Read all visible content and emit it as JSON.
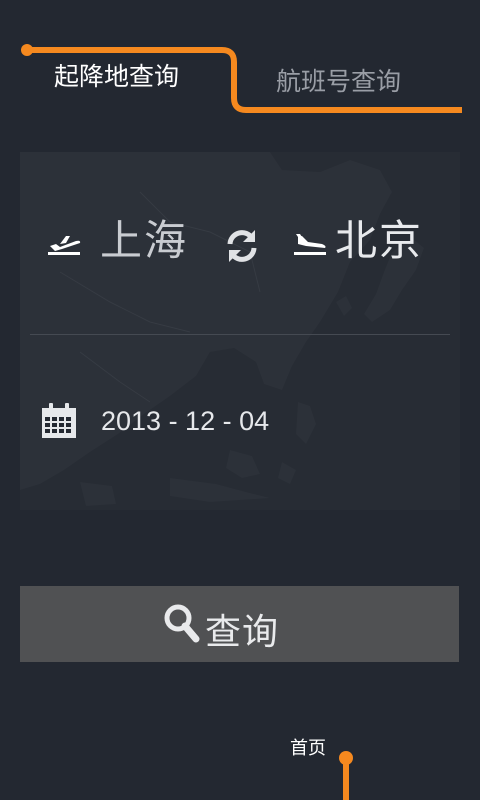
{
  "tabs": {
    "active": "起降地查询",
    "inactive": "航班号查询"
  },
  "route": {
    "departure_city": "上海",
    "arrival_city": "北京",
    "departure_icon": "takeoff-plane-icon",
    "arrival_icon": "landing-plane-icon",
    "swap_icon": "swap-refresh-icon"
  },
  "date": {
    "icon": "calendar-icon",
    "value": "2013 - 12 - 04"
  },
  "search": {
    "icon": "magnifier-icon",
    "label": "查询"
  },
  "nav": {
    "home_label": "首页"
  },
  "colors": {
    "background": "#232831",
    "accent": "#f5891f",
    "button": "#505153",
    "inactive_text": "#9a9ea6"
  }
}
